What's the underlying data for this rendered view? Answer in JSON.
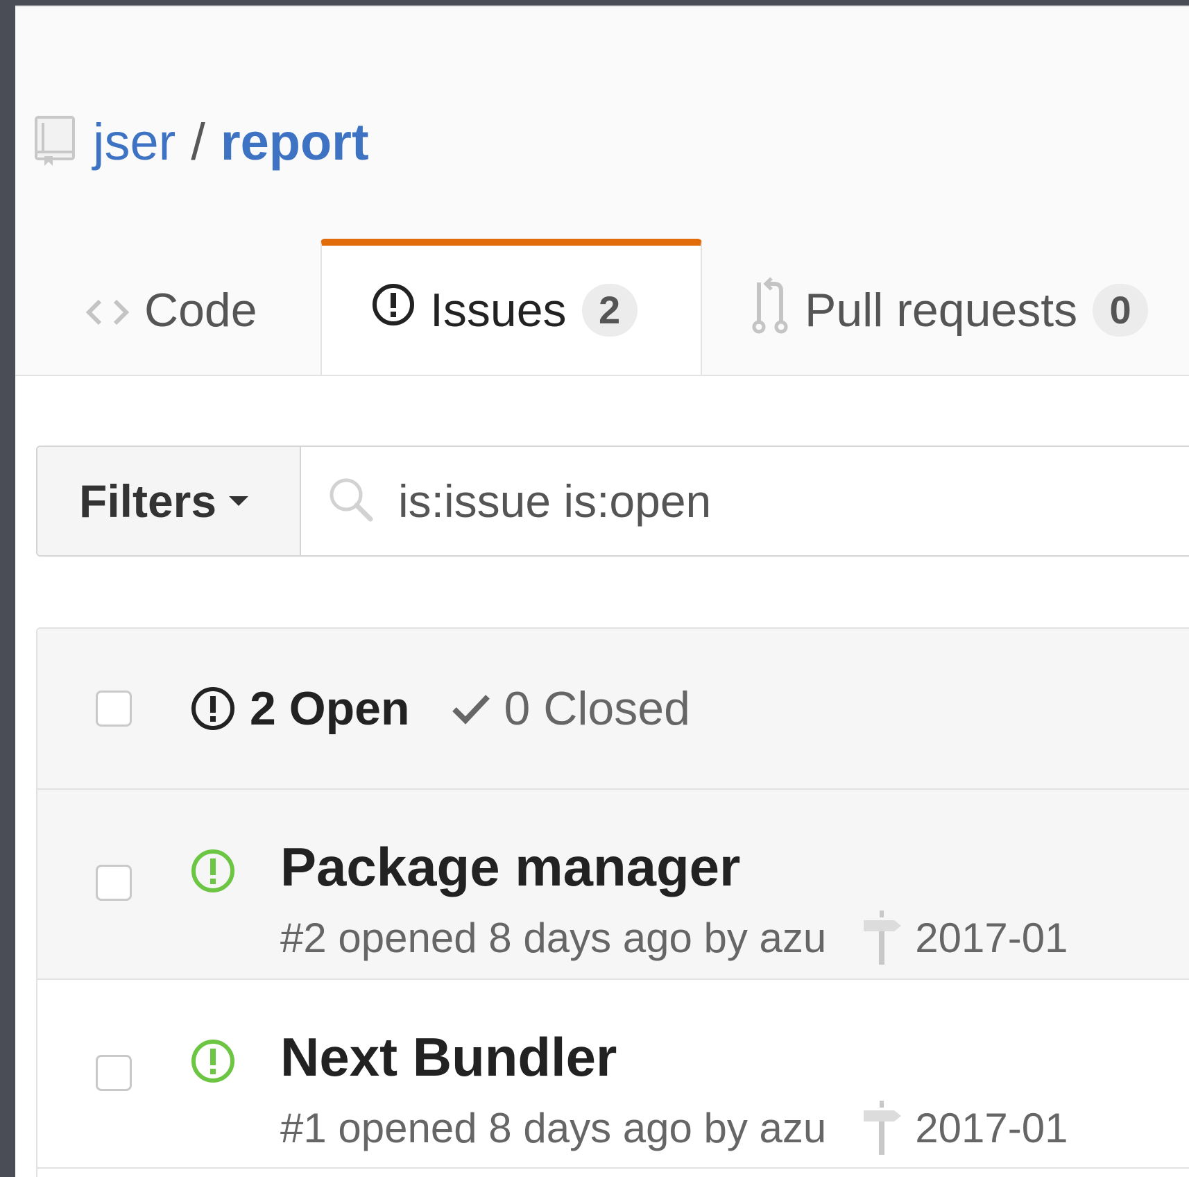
{
  "repo": {
    "owner": "jser",
    "separator": "/",
    "name": "report",
    "icon": "repo-icon"
  },
  "tabs": [
    {
      "label": "Code",
      "icon": "code-icon",
      "selected": false
    },
    {
      "label": "Issues",
      "icon": "issue-opened-icon",
      "count": "2",
      "selected": true
    },
    {
      "label": "Pull requests",
      "icon": "git-pull-request-icon",
      "count": "0",
      "selected": false
    }
  ],
  "filters": {
    "button_label": "Filters",
    "search_value": "is:issue is:open",
    "search_icon": "search-icon"
  },
  "issues_header": {
    "open_label": "2 Open",
    "closed_label": "0 Closed"
  },
  "issues": [
    {
      "title": "Package manager",
      "meta": "#2 opened 8 days ago by azu",
      "milestone": "2017-01",
      "status": "open"
    },
    {
      "title": "Next Bundler",
      "meta": "#1 opened 8 days ago by azu",
      "milestone": "2017-01",
      "status": "open"
    }
  ],
  "colors": {
    "link_blue": "#3e73c4",
    "tab_accent": "#e36c0a",
    "open_green": "#6cc644"
  }
}
